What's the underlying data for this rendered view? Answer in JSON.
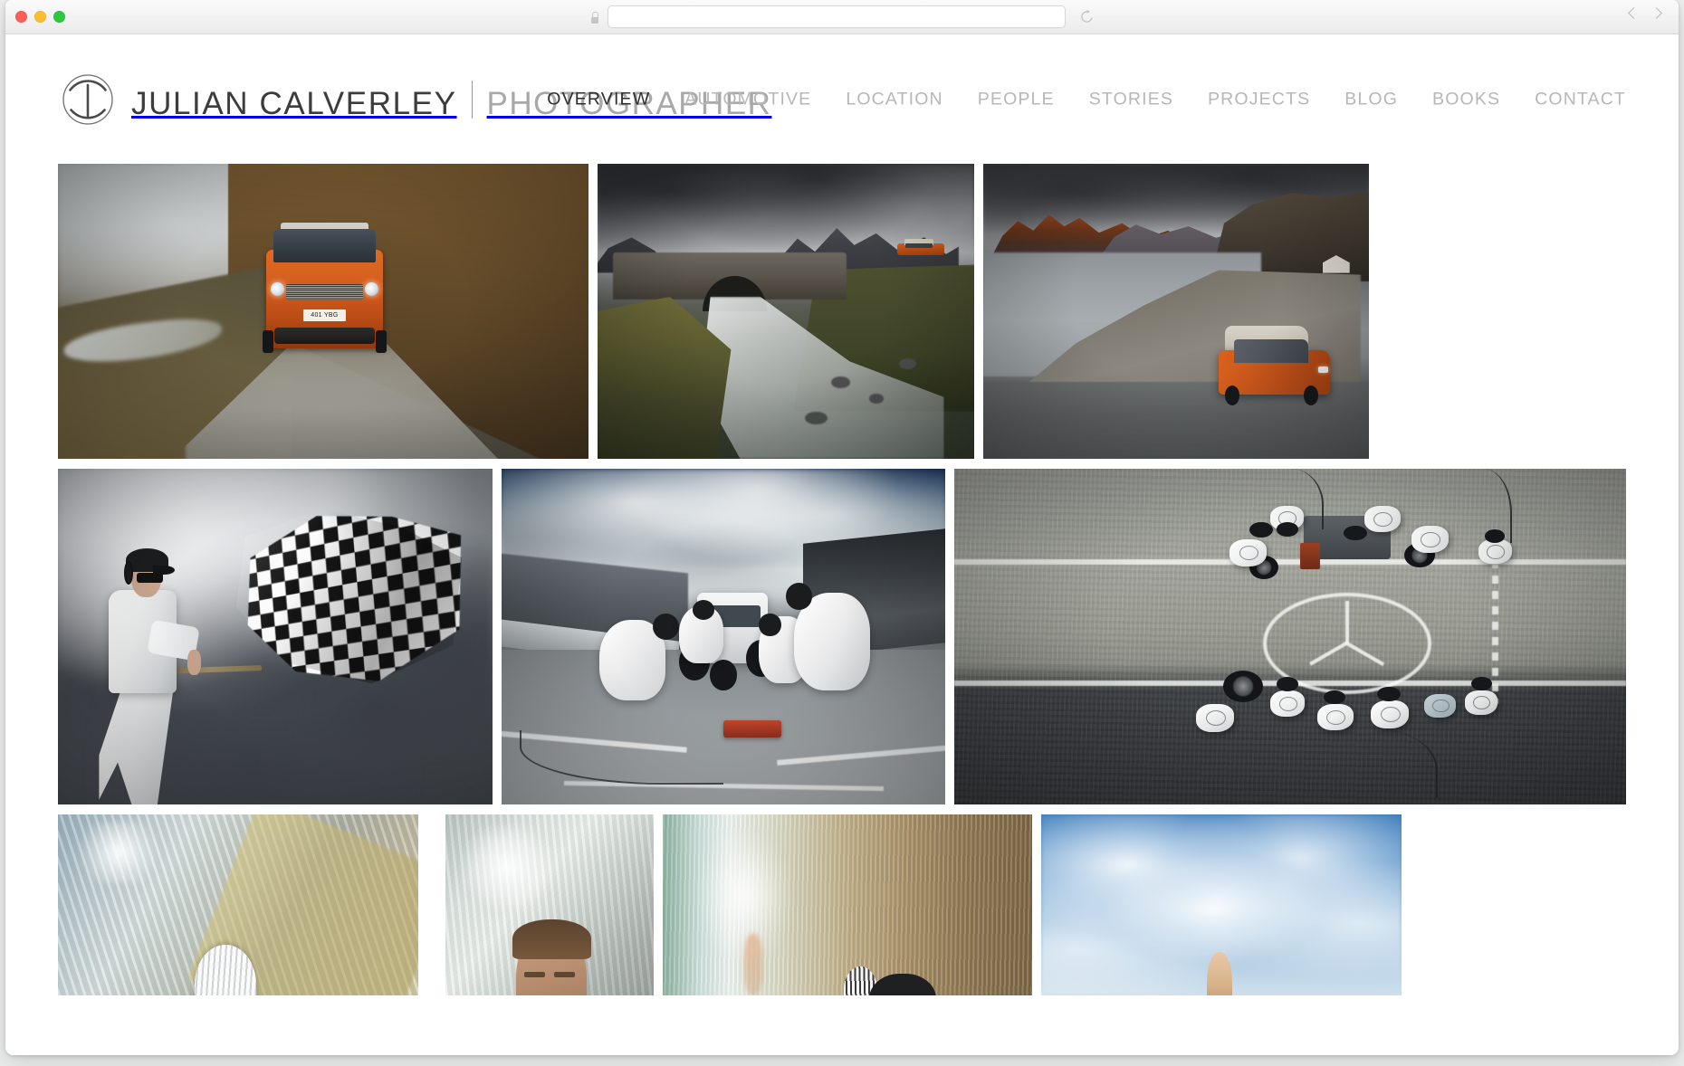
{
  "browser": {
    "url_value": "",
    "url_placeholder": "",
    "lock_icon": "lock-icon",
    "reload_icon": "reload-icon",
    "back_icon": "chevron-left-icon",
    "forward_icon": "chevron-right-icon",
    "traffic_lights": [
      {
        "name": "close",
        "color": "#fb5f57"
      },
      {
        "name": "minimize",
        "color": "#fbbe2e"
      },
      {
        "name": "maximize",
        "color": "#2bc840"
      }
    ]
  },
  "site": {
    "brand_mark_icon": "circle-monogram-icon",
    "brand_name": "JULIAN CALVERLEY",
    "brand_role": "PHOTOGRAPHER",
    "nav": [
      {
        "label": "OVERVIEW",
        "active": true
      },
      {
        "label": "AUTOMOTIVE",
        "active": false
      },
      {
        "label": "LOCATION",
        "active": false
      },
      {
        "label": "PEOPLE",
        "active": false
      },
      {
        "label": "STORIES",
        "active": false
      },
      {
        "label": "PROJECTS",
        "active": false
      },
      {
        "label": "BLOG",
        "active": false
      },
      {
        "label": "BOOKS",
        "active": false
      },
      {
        "label": "CONTACT",
        "active": false
      }
    ],
    "colors": {
      "nav_active": "#2e2e2e",
      "nav_inactive": "#b7b7b7",
      "brand_name": "#3c3c3c",
      "brand_role": "#a8a8a8",
      "page_background": "#ffffff"
    }
  },
  "gallery": {
    "rows": [
      {
        "tiles": [
          {
            "name": "tile-discovery-track",
            "caption": "Orange Land Rover Discovery driving a muddy Highland track",
            "plate": "401 YBG"
          },
          {
            "name": "tile-sligachan-bridge",
            "caption": "Orange Land Rover above the old Sligachan stone bridge, Skye"
          },
          {
            "name": "tile-elgol-shore",
            "caption": "Orange Land Rover on the Elgol slipway below the red Cuillin"
          }
        ]
      },
      {
        "tiles": [
          {
            "name": "tile-chequered-flag",
            "caption": "Race marshal waving a chequered flag against storm clouds"
          },
          {
            "name": "tile-pit-stop-van",
            "caption": "Pit crew servicing a Mercedes van on the pit lane"
          },
          {
            "name": "tile-aerial-pit-crew",
            "caption": "Aerial view of a Mercedes pit crew around a painted star"
          }
        ]
      },
      {
        "tiles": [
          {
            "name": "tile-cyclist-velodrome",
            "caption": "Cyclist in a white helmet inside a sunlit velodrome"
          },
          {
            "name": "tile-athlete-portrait",
            "caption": "Portrait of a man in a bright industrial space"
          },
          {
            "name": "tile-motion-blur",
            "caption": "Motion-blurred panning shot"
          },
          {
            "name": "tile-sky-figure",
            "caption": "Figure against a blue sky with scattered cloud"
          }
        ]
      }
    ]
  }
}
